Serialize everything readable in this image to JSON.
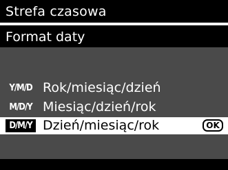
{
  "header": {
    "title": "Strefa czasowa"
  },
  "submenu": {
    "title": "Format daty"
  },
  "options": [
    {
      "icon": "Y/M/D",
      "label": "Rok/miesiąc/dzień",
      "selected": false
    },
    {
      "icon": "M/D/Y",
      "label": "Miesiąc/dzień/rok",
      "selected": false
    },
    {
      "icon": "D/M/Y",
      "label": "Dzień/miesiąc/rok",
      "selected": true
    }
  ],
  "confirm": {
    "label": "OK"
  },
  "colors": {
    "background": "#000000",
    "panel": "#4a4a4a",
    "highlight": "#ffffff",
    "text": "#ffffff"
  }
}
